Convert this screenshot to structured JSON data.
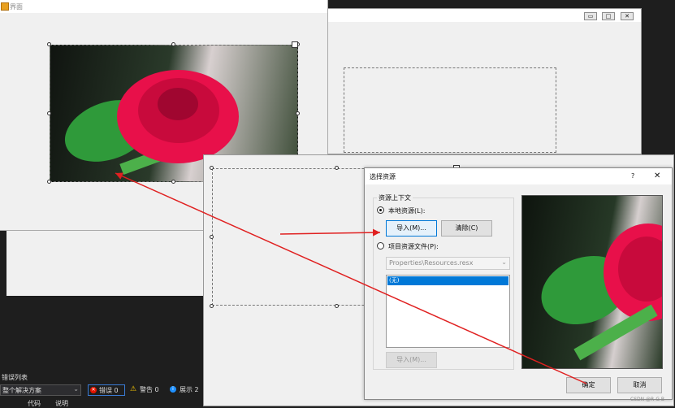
{
  "form_window": {
    "title": "界面"
  },
  "dialog": {
    "title": "选择资源",
    "help_label": "?",
    "close_label": "✕",
    "group_label": "资源上下文",
    "local_resource_label": "本地资源(L):",
    "import_button": "导入(M)...",
    "clear_button": "清除(C)",
    "project_resource_label": "项目资源文件(P):",
    "resx_select_value": "Properties\\Resources.resx",
    "list_selected_item": "(无)",
    "import_disabled_button": "导入(M)...",
    "ok_button": "确定",
    "cancel_button": "取消"
  },
  "bottom_panel": {
    "title": "错误列表",
    "scope_value": "整个解决方案",
    "errors_label": "错误 0",
    "warnings_label": "警告 0",
    "messages_label": "展示 2",
    "tab_code": "代码",
    "tab_desc": "说明"
  },
  "watermark": "CSDN @R-G-B",
  "colors": {
    "accent": "#0078d7",
    "arrow": "#e02020",
    "dark_bg": "#1e1e1e"
  }
}
